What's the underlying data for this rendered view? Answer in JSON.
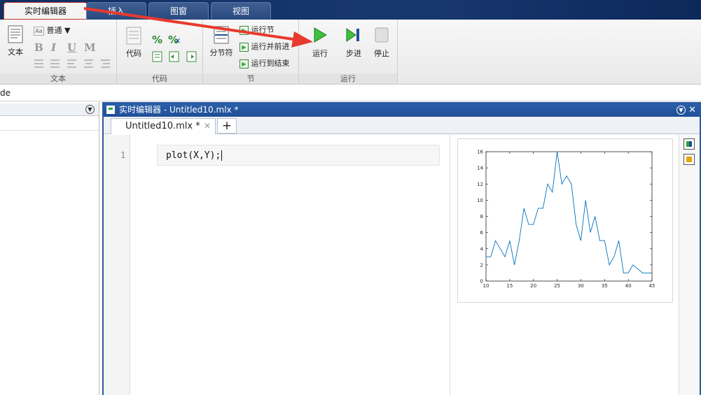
{
  "ribbon_tabs": [
    {
      "label": "实时编辑器",
      "active": true
    },
    {
      "label": "插入",
      "active": false
    },
    {
      "label": "图窗",
      "active": false
    },
    {
      "label": "视图",
      "active": false
    }
  ],
  "text_group": {
    "label": "文本",
    "text_button": "文本",
    "style_select": "普通",
    "format_buttons": [
      "B",
      "I",
      "U",
      "M"
    ]
  },
  "code_group": {
    "label": "代码",
    "code_button": "代码"
  },
  "section_group": {
    "label": "节",
    "section_break": "分节符",
    "run_section": "运行节",
    "run_and_advance": "运行并前进",
    "run_to_end": "运行到结束"
  },
  "run_group": {
    "label": "运行",
    "run": "运行",
    "step": "步进",
    "stop": "停止"
  },
  "address_fragment": "de",
  "editor": {
    "title": "实时编辑器 - Untitled10.mlx *",
    "doc_tab": "Untitled10.mlx *",
    "add_tab": "+",
    "line_number": "1",
    "code": "plot(X,Y);"
  },
  "colors": {
    "title_bar": "#1f4f97",
    "plot_line": "#0072bd",
    "annotation_arrow": "#e83a2e",
    "run_green": "#2aa52a"
  },
  "chart_data": {
    "type": "line",
    "x": [
      10,
      11,
      12,
      13,
      14,
      15,
      16,
      17,
      18,
      19,
      20,
      21,
      22,
      23,
      24,
      25,
      26,
      27,
      28,
      29,
      30,
      31,
      32,
      33,
      34,
      35,
      36,
      37,
      38,
      39,
      40,
      41,
      42,
      43,
      44,
      45
    ],
    "series": [
      {
        "values": [
          3,
          3,
          5,
          4,
          3,
          5,
          2,
          5,
          9,
          7,
          7,
          9,
          9,
          12,
          11,
          16,
          12,
          13,
          12,
          7,
          5,
          10,
          6,
          8,
          5,
          5,
          2,
          3,
          5,
          1,
          1,
          2,
          1.5,
          1,
          1,
          1
        ]
      }
    ],
    "xlim": [
      10,
      45
    ],
    "ylim": [
      0,
      16
    ],
    "xticks": [
      "10",
      "15",
      "20",
      "25",
      "30",
      "35",
      "40",
      "45"
    ],
    "yticks": [
      "0",
      "2",
      "4",
      "6",
      "8",
      "10",
      "12",
      "14",
      "16"
    ],
    "grid": false
  }
}
